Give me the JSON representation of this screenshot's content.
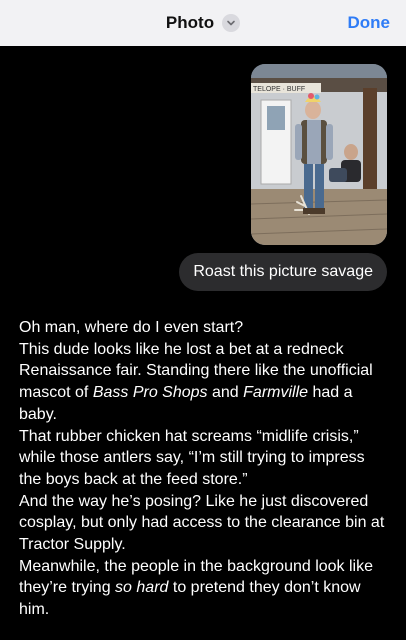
{
  "header": {
    "title": "Photo",
    "done_label": "Done",
    "dropdown_icon": "chevron-down-icon"
  },
  "colors": {
    "header_bg": "#f2f2f4",
    "accent": "#2f7cf6",
    "bubble_bg": "#2c2c2e",
    "background": "#000000"
  },
  "photo": {
    "sign_text": "TELOPE · BUFF"
  },
  "user_message": "Roast this picture savage",
  "response": {
    "p1": "Oh man, where do I even start?",
    "p2": "This dude looks like he lost a bet at a redneck Renaissance fair. Standing there like the unofficial mascot of",
    "p2_em1": "Bass Pro Shops",
    "p2_mid": "and",
    "p2_em2": "Farmville",
    "p2_end": "had a baby.",
    "p3": "That rubber chicken hat screams “midlife crisis,” while those antlers say, “I’m still trying to impress the boys back at the feed store.”",
    "p4": "And the way he’s posing? Like he just discovered cosplay, but only had access to the clearance bin at Tractor Supply.",
    "p5_start": "Meanwhile, the people in the background look like they’re trying",
    "p5_em": "so hard",
    "p5_end": "to pretend they don’t know him."
  }
}
